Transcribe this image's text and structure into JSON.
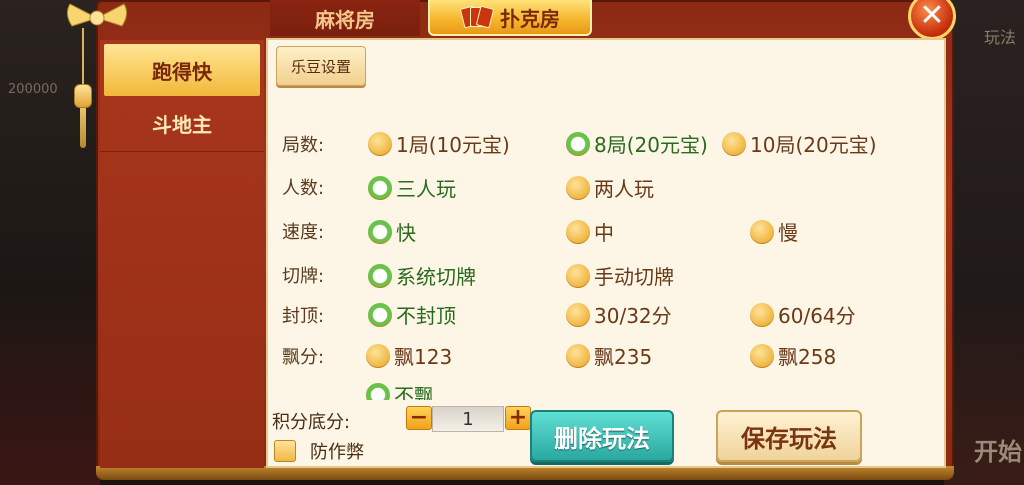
{
  "tabs": {
    "mahjong": "麻将房",
    "poker": "扑克房"
  },
  "sidebar": {
    "items": [
      {
        "label": "跑得快",
        "active": true
      },
      {
        "label": "斗地主",
        "active": false
      }
    ]
  },
  "settings_button": "乐豆设置",
  "rows": {
    "rounds": {
      "label": "局数:",
      "options": [
        "1局(10元宝)",
        "8局(20元宝)",
        "10局(20元宝)"
      ],
      "selected": 1
    },
    "players": {
      "label": "人数:",
      "options": [
        "三人玩",
        "两人玩"
      ],
      "selected": 0
    },
    "speed": {
      "label": "速度:",
      "options": [
        "快",
        "中",
        "慢"
      ],
      "selected": 0
    },
    "cut": {
      "label": "切牌:",
      "options": [
        "系统切牌",
        "手动切牌"
      ],
      "selected": 0
    },
    "cap": {
      "label": "封顶:",
      "options": [
        "不封顶",
        "30/32分",
        "60/64分"
      ],
      "selected": 0
    },
    "float": {
      "label": "飘分:",
      "options": [
        "飘123",
        "飘235",
        "飘258",
        "不飘"
      ],
      "selected": 3
    }
  },
  "score": {
    "label": "积分底分:",
    "minus": "−",
    "plus": "+",
    "value": "1"
  },
  "anti_cheat": {
    "label": "防作弊",
    "checked": false
  },
  "buttons": {
    "delete": "删除玩法",
    "save": "保存玩法"
  },
  "background": {
    "left_text": "200000",
    "right_text_1": "玩法",
    "right_text_2": "开始"
  },
  "colors": {
    "frame": "#a5341a",
    "panel": "#fdf6e6",
    "gold": "#f5b42a",
    "teal": "#2aa8a0",
    "selected_text": "#2a6a1e"
  }
}
